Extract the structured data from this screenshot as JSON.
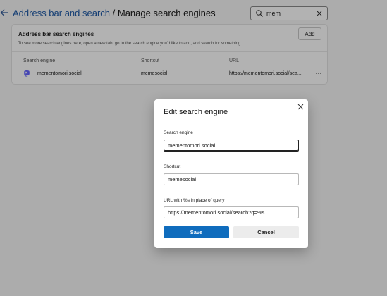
{
  "header": {
    "breadcrumb_link": "Address bar and search",
    "separator": " / ",
    "current": "Manage search engines",
    "back_icon": "arrow-left-icon"
  },
  "search": {
    "value": "mem",
    "icon": "search-icon",
    "clear_icon": "close-icon"
  },
  "card": {
    "title": "Address bar search engines",
    "description": "To see more search engines here, open a new tab, go to the search engine you'd like to add, and search for something",
    "add_label": "Add",
    "columns": [
      "Search engine",
      "Shortcut",
      "URL"
    ],
    "rows": [
      {
        "name": "mementomori.social",
        "shortcut": "memesocial",
        "url": "https://mementomori.social/sea...",
        "icon": "mastodon-icon",
        "more_label": "⋯"
      }
    ]
  },
  "dialog": {
    "title": "Edit search engine",
    "close_icon": "close-icon",
    "engine_label": "Search engine",
    "engine_value": "mementomori.social",
    "shortcut_label": "Shortcut",
    "shortcut_value": "memesocial",
    "url_label": "URL with %s in place of query",
    "url_value": "https://mementomori.social/search?q=%s",
    "save_label": "Save",
    "cancel_label": "Cancel"
  },
  "colors": {
    "accent": "#0f6cbd",
    "link": "#1f5aa6",
    "mastodon": "#6364ff"
  }
}
